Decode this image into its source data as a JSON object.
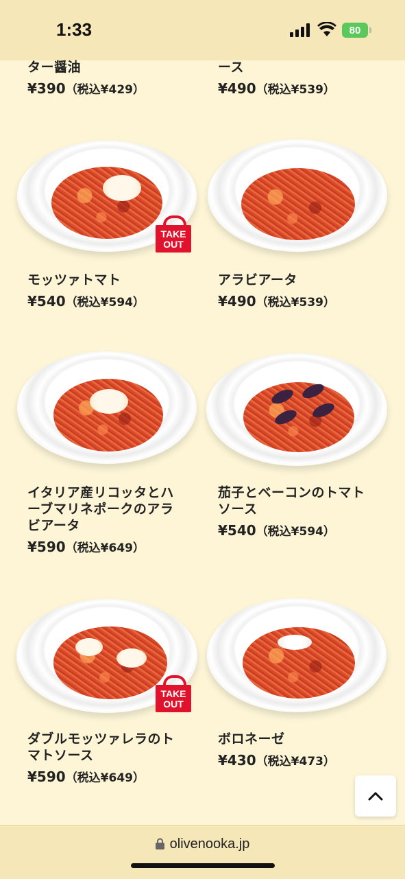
{
  "status": {
    "time": "1:33",
    "battery": "80"
  },
  "items": [
    {
      "name": "ター醤油",
      "price": "¥390",
      "tax": "（税込¥429）"
    },
    {
      "name": "ース",
      "price": "¥490",
      "tax": "（税込¥539）"
    },
    {
      "name": "モッツァトマト",
      "price": "¥540",
      "tax": "（税込¥594）",
      "badge": "TAKE OUT"
    },
    {
      "name": "アラビアータ",
      "price": "¥490",
      "tax": "（税込¥539）"
    },
    {
      "name_lines": [
        "イタリア産リコッタとハ",
        "ーブマリネポークのアラ",
        "ビアータ"
      ],
      "price": "¥590",
      "tax": "（税込¥649）"
    },
    {
      "name_lines": [
        "茄子とベーコンのトマト",
        "ソース"
      ],
      "price": "¥540",
      "tax": "（税込¥594）"
    },
    {
      "name_lines": [
        "ダブルモッツァレラのト",
        "マトソース"
      ],
      "price": "¥590",
      "tax": "（税込¥649）",
      "badge": "TAKE OUT"
    },
    {
      "name": "ボロネーゼ",
      "price": "¥430",
      "tax": "（税込¥473）"
    }
  ],
  "badge_lines": [
    "TAKE",
    "OUT"
  ],
  "browser": {
    "url": "olivenooka.jp"
  }
}
